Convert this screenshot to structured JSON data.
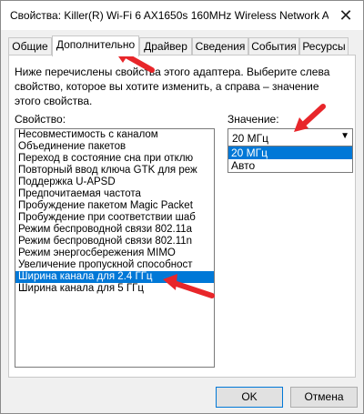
{
  "window": {
    "title": "Свойства: Killer(R) Wi-Fi 6 AX1650s 160MHz Wireless Network Ad...",
    "close_glyph": "✕"
  },
  "tabs": [
    {
      "label": "Общие"
    },
    {
      "label": "Дополнительно"
    },
    {
      "label": "Драйвер"
    },
    {
      "label": "Сведения"
    },
    {
      "label": "События"
    },
    {
      "label": "Ресурсы"
    }
  ],
  "panel": {
    "description": "Ниже перечислены свойства этого адаптера. Выберите слева свойство, которое вы хотите изменить, а справа – значение этого свойства.",
    "property_label": "Свойство:",
    "value_label": "Значение:"
  },
  "properties": [
    {
      "label": "Несовместимость с каналом"
    },
    {
      "label": "Объединение пакетов"
    },
    {
      "label": "Переход в состояние сна при отклю"
    },
    {
      "label": "Повторный ввод ключа GTK для реж"
    },
    {
      "label": "Поддержка U-APSD"
    },
    {
      "label": "Предпочитаемая частота"
    },
    {
      "label": "Пробуждение пакетом Magic Packet"
    },
    {
      "label": "Пробуждение при соответствии шаб"
    },
    {
      "label": "Режим беспроводной связи 802.11a"
    },
    {
      "label": "Режим беспроводной связи 802.11n"
    },
    {
      "label": "Режим энергосбережения MIMO"
    },
    {
      "label": "Увеличение пропускной способност"
    },
    {
      "label": "Ширина канала для 2.4 ГГц",
      "selected": true
    },
    {
      "label": "Ширина канала для 5 ГГц"
    }
  ],
  "value": {
    "current": "20 МГц",
    "options": [
      {
        "label": "20 МГц",
        "selected": true
      },
      {
        "label": "Авто"
      }
    ]
  },
  "buttons": {
    "ok": "OK",
    "cancel": "Отмена"
  },
  "colors": {
    "selection": "#0078d7",
    "annotation_arrow": "#e8262a"
  },
  "icons": [
    "close-icon",
    "chevron-down-icon",
    "annotation-arrow"
  ]
}
